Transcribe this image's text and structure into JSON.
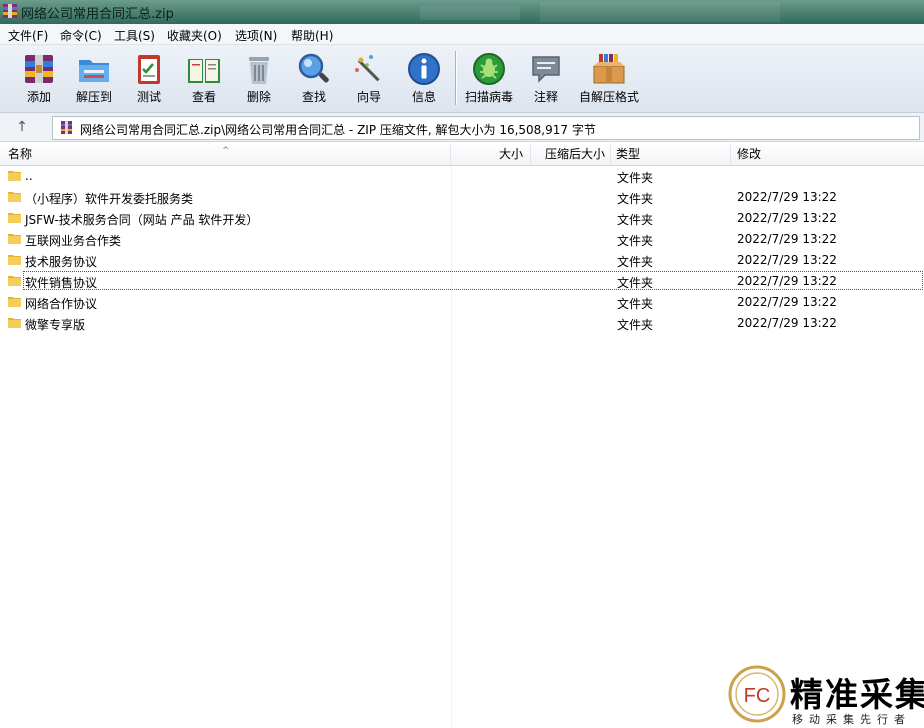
{
  "window": {
    "title": "网络公司常用合同汇总.zip"
  },
  "menu": [
    "文件(F)",
    "命令(C)",
    "工具(S)",
    "收藏夹(O)",
    "选项(N)",
    "帮助(H)"
  ],
  "toolbar": [
    {
      "label": "添加",
      "icon": "add-archive-icon"
    },
    {
      "label": "解压到",
      "icon": "extract-to-icon"
    },
    {
      "label": "测试",
      "icon": "test-icon"
    },
    {
      "label": "查看",
      "icon": "view-book-icon"
    },
    {
      "label": "删除",
      "icon": "trash-icon"
    },
    {
      "label": "查找",
      "icon": "magnifier-icon"
    },
    {
      "label": "向导",
      "icon": "wizard-wand-icon"
    },
    {
      "label": "信息",
      "icon": "info-icon"
    },
    {
      "label": "扫描病毒",
      "icon": "virus-scan-icon"
    },
    {
      "label": "注释",
      "icon": "comment-icon"
    },
    {
      "label": "自解压格式",
      "icon": "sfx-box-icon"
    }
  ],
  "address": {
    "path": "网络公司常用合同汇总.zip\\网络公司常用合同汇总 - ZIP 压缩文件, 解包大小为 16,508,917 字节"
  },
  "columns": {
    "name": "名称",
    "size": "大小",
    "packed": "压缩后大小",
    "type": "类型",
    "modified": "修改"
  },
  "rows": [
    {
      "name": "..",
      "type": "文件夹",
      "modified": ""
    },
    {
      "name": "（小程序）软件开发委托服务类",
      "type": "文件夹",
      "modified": "2022/7/29 13:22"
    },
    {
      "name": "JSFW-技术服务合同（网站 产品 软件开发）",
      "type": "文件夹",
      "modified": "2022/7/29 13:22"
    },
    {
      "name": "互联网业务合作类",
      "type": "文件夹",
      "modified": "2022/7/29 13:22"
    },
    {
      "name": "技术服务协议",
      "type": "文件夹",
      "modified": "2022/7/29 13:22"
    },
    {
      "name": "软件销售协议",
      "type": "文件夹",
      "modified": "2022/7/29 13:22"
    },
    {
      "name": "网络合作协议",
      "type": "文件夹",
      "modified": "2022/7/29 13:22"
    },
    {
      "name": "微擎专享版",
      "type": "文件夹",
      "modified": "2022/7/29 13:22"
    }
  ],
  "watermark": {
    "seal": "FC",
    "title": "精准采集",
    "subtitle": "移动采集先行者"
  }
}
